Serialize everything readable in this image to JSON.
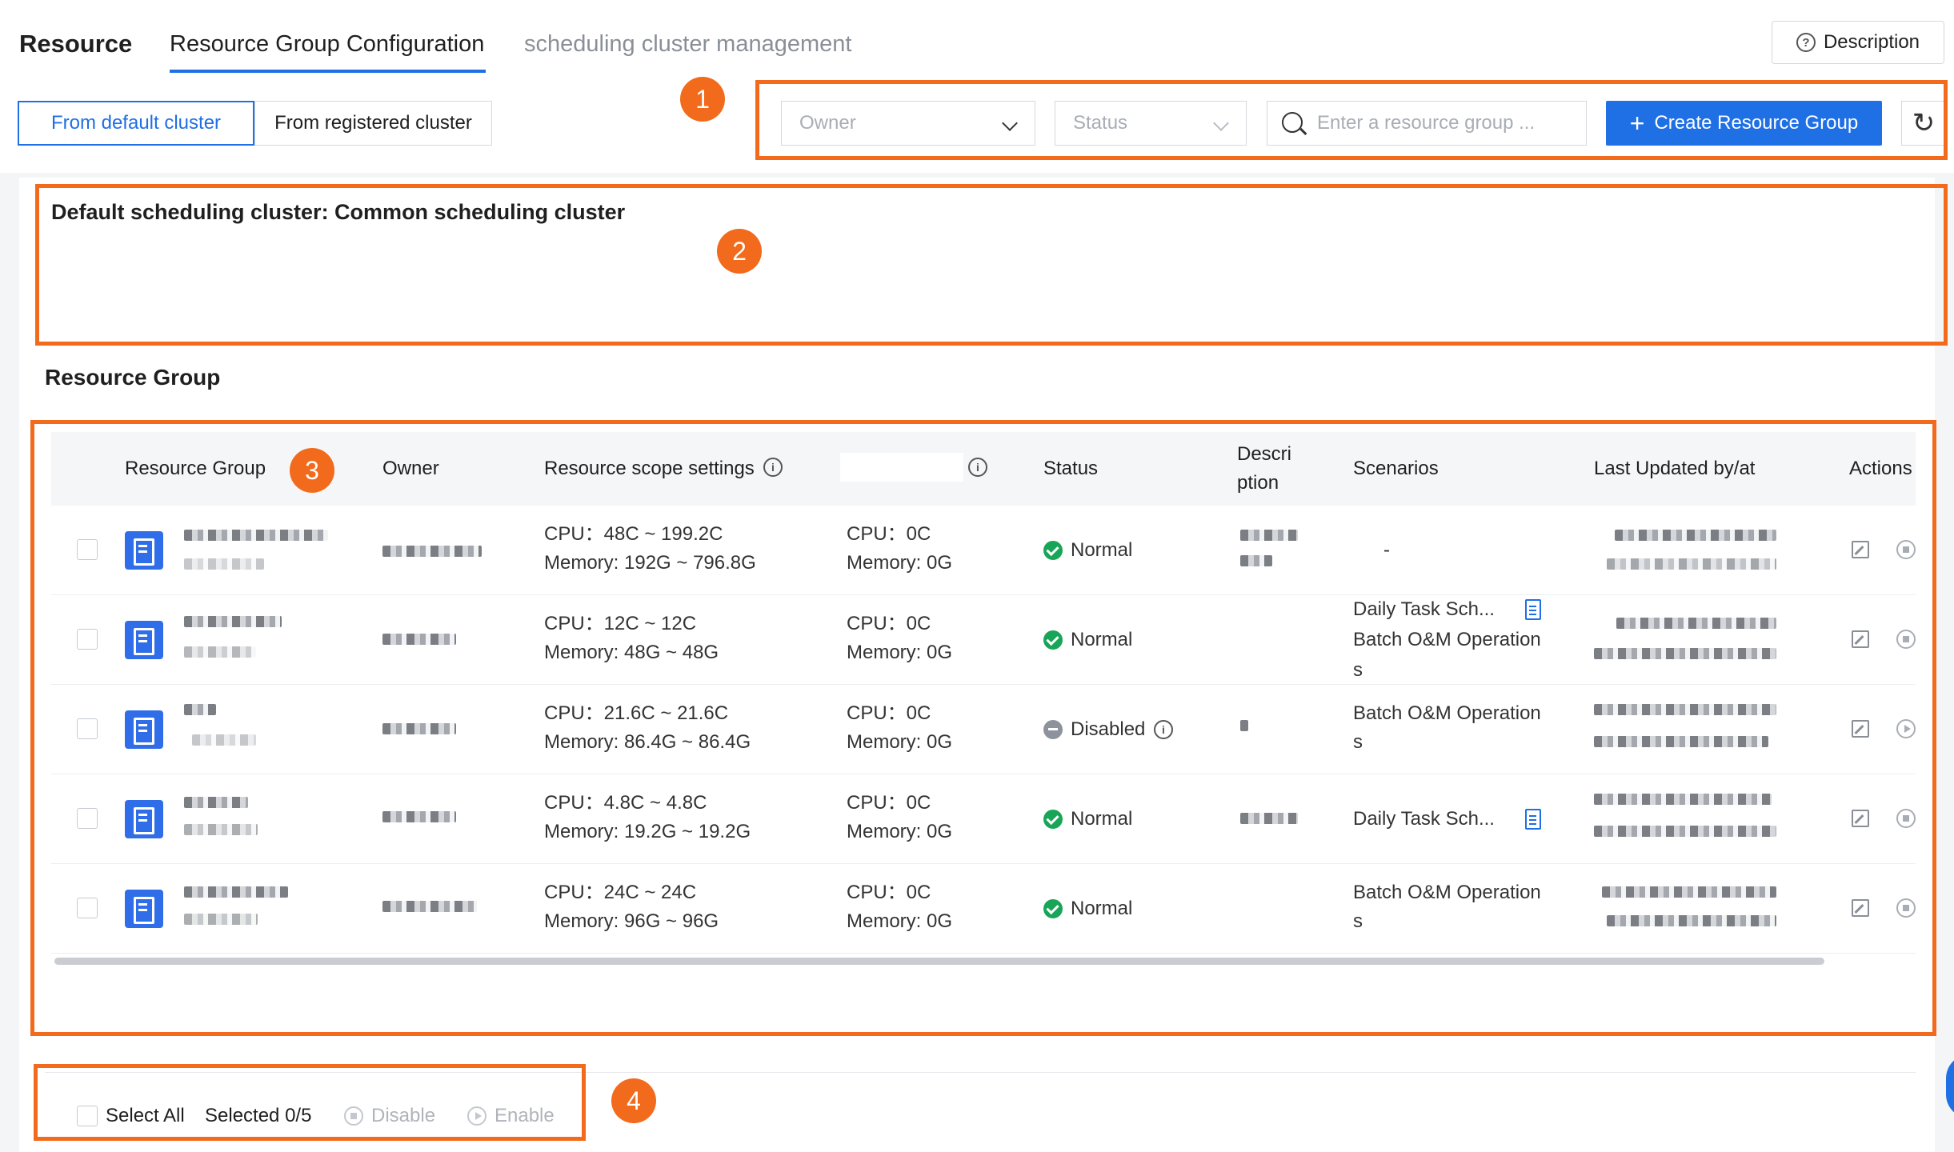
{
  "header": {
    "app_title": "Resource",
    "tabs": [
      {
        "label": "Resource Group Configuration",
        "active": true
      },
      {
        "label": "scheduling cluster management",
        "active": false
      }
    ],
    "description_button": "Description",
    "description_icon": "question-circle-icon"
  },
  "cluster_toggle": {
    "options": [
      "From default cluster",
      "From registered cluster"
    ],
    "selected": "From default cluster"
  },
  "toolbar": {
    "owner_placeholder": "Owner",
    "status_placeholder": "Status",
    "search_placeholder": "Enter a resource group ...",
    "create_button": "Create Resource Group",
    "create_icon": "+",
    "refresh_icon": "↻"
  },
  "cluster_info": {
    "title": "Default scheduling cluster: Common scheduling cluster"
  },
  "resource_group_section": {
    "title": "Resource Group"
  },
  "table": {
    "columns": {
      "resource_group": "Resource Group",
      "owner": "Owner",
      "scope": "Resource scope settings",
      "status": "Status",
      "description_line1": "Descri",
      "description_line2": "ption",
      "scenarios": "Scenarios",
      "last_updated": "Last Updated by/at",
      "actions": "Actions"
    },
    "rows": [
      {
        "scope_cpu": "CPU：48C ~ 199.2C",
        "scope_memory": "Memory: 192G ~ 796.8G",
        "used_cpu": "CPU：0C",
        "used_memory": "Memory: 0G",
        "status": "Normal",
        "status_kind": "normal",
        "description": "",
        "scenarios_line1": "-",
        "scenarios_line2": "",
        "scenarios_line3": "",
        "scenario_doc_icon": false
      },
      {
        "scope_cpu": "CPU：12C ~ 12C",
        "scope_memory": "Memory: 48G ~ 48G",
        "used_cpu": "CPU：0C",
        "used_memory": "Memory: 0G",
        "status": "Normal",
        "status_kind": "normal",
        "description": "",
        "scenarios_line1": "Daily Task Sch...",
        "scenarios_line2": "Batch O&M Operation",
        "scenarios_line3": "s",
        "scenario_doc_icon": true
      },
      {
        "scope_cpu": "CPU：21.6C ~ 21.6C",
        "scope_memory": "Memory: 86.4G ~ 86.4G",
        "used_cpu": "CPU：0C",
        "used_memory": "Memory: 0G",
        "status": "Disabled",
        "status_kind": "disabled",
        "description": "",
        "scenarios_line1": "Batch O&M Operation",
        "scenarios_line2": "s",
        "scenarios_line3": "",
        "scenario_doc_icon": false
      },
      {
        "scope_cpu": "CPU：4.8C ~ 4.8C",
        "scope_memory": "Memory: 19.2G ~ 19.2G",
        "used_cpu": "CPU：0C",
        "used_memory": "Memory: 0G",
        "status": "Normal",
        "status_kind": "normal",
        "description": "",
        "scenarios_line1": "Daily Task Sch...",
        "scenarios_line2": "",
        "scenarios_line3": "",
        "scenario_doc_icon": true
      },
      {
        "scope_cpu": "CPU：24C ~ 24C",
        "scope_memory": "Memory: 96G ~ 96G",
        "used_cpu": "CPU：0C",
        "used_memory": "Memory: 0G",
        "status": "Normal",
        "status_kind": "normal",
        "description": "",
        "scenarios_line1": "Batch O&M Operation",
        "scenarios_line2": "s",
        "scenarios_line3": "",
        "scenario_doc_icon": false
      }
    ]
  },
  "footer": {
    "select_all": "Select All",
    "selected": "Selected 0/5",
    "disable": "Disable",
    "enable": "Enable"
  },
  "annotations": [
    "1",
    "2",
    "3",
    "4"
  ],
  "colors": {
    "primary": "#1f6fe5",
    "annotation": "#f26a1b",
    "status_normal": "#18a557",
    "status_disabled": "#8d939c"
  }
}
